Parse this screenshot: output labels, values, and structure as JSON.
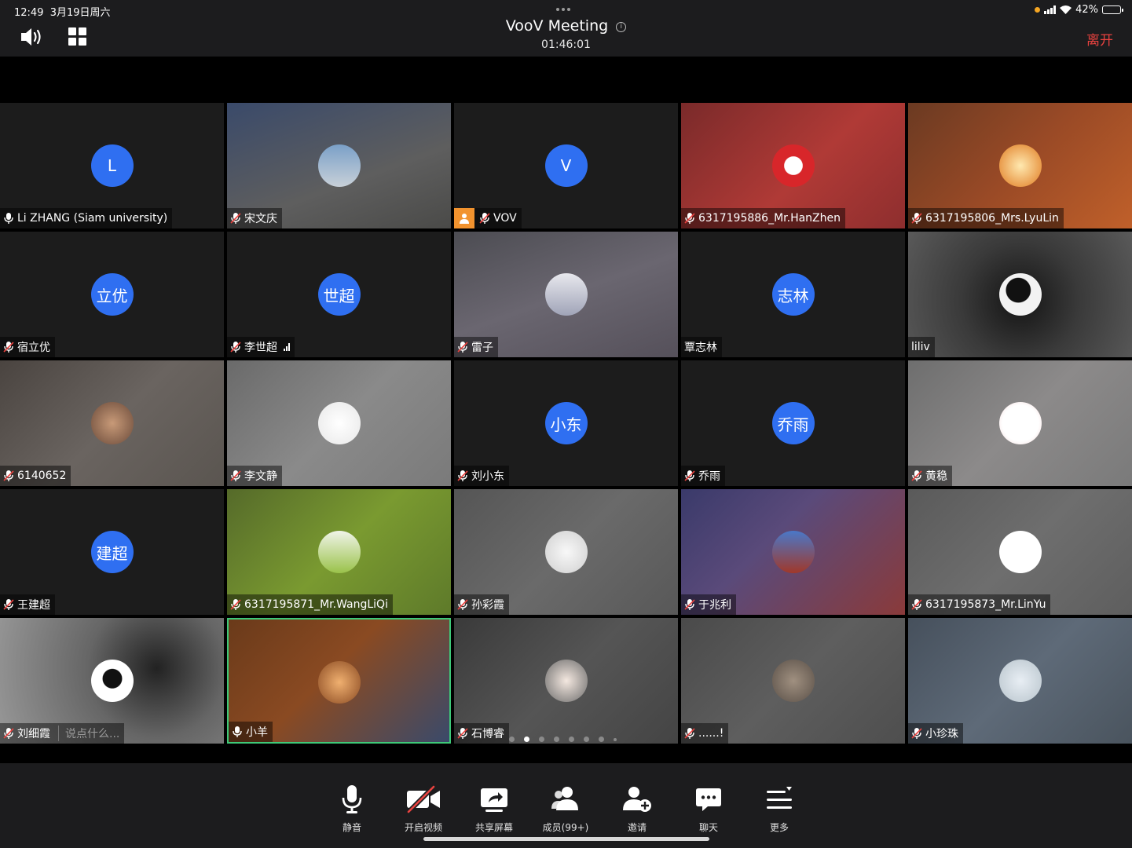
{
  "status_bar": {
    "time": "12:49",
    "date": "3月19日周六",
    "battery_percent_label": "42%",
    "battery_level": 0.42
  },
  "meeting": {
    "title": "VooV Meeting",
    "duration": "01:46:01",
    "leave_label": "离开"
  },
  "colors": {
    "accent_blue": "#2f6ff1",
    "leave_red": "#e8423f",
    "active_border": "#3ec978",
    "screen_share_badge": "#f2932e"
  },
  "icons": {
    "speaker": "speaker-icon",
    "grid": "grid-view-icon",
    "mic_muted": "mic-muted-icon",
    "mic_on": "mic-icon",
    "screen_share": "screen-share-icon",
    "signal": "signal-icon"
  },
  "participants": [
    {
      "name": "Li ZHANG (Siam university)",
      "avatar_text": "L",
      "mic": "on"
    },
    {
      "name": "宋文庆",
      "avatar_text": "",
      "mic": "muted"
    },
    {
      "name": "VOV",
      "avatar_text": "V",
      "mic": "muted",
      "screen_share": true
    },
    {
      "name": "6317195886_Mr.HanZhen",
      "avatar_text": "",
      "mic": "muted"
    },
    {
      "name": "6317195806_Mrs.LyuLin",
      "avatar_text": "",
      "mic": "muted"
    },
    {
      "name": "宿立优",
      "avatar_text": "立优",
      "mic": "muted"
    },
    {
      "name": "李世超",
      "avatar_text": "世超",
      "mic": "muted",
      "signal": true
    },
    {
      "name": "雷子",
      "avatar_text": "",
      "mic": "muted"
    },
    {
      "name": "覃志林",
      "avatar_text": "志林",
      "mic": "none"
    },
    {
      "name": "liliv",
      "avatar_text": "",
      "mic": "none"
    },
    {
      "name": "6140652",
      "avatar_text": "",
      "mic": "muted"
    },
    {
      "name": "李文静",
      "avatar_text": "",
      "mic": "muted"
    },
    {
      "name": "刘小东",
      "avatar_text": "小东",
      "mic": "muted"
    },
    {
      "name": "乔雨",
      "avatar_text": "乔雨",
      "mic": "muted"
    },
    {
      "name": "黄稳",
      "avatar_text": "",
      "mic": "muted"
    },
    {
      "name": "王建超",
      "avatar_text": "建超",
      "mic": "muted"
    },
    {
      "name": "6317195871_Mr.WangLiQi",
      "avatar_text": "",
      "mic": "muted"
    },
    {
      "name": "孙彩霞",
      "avatar_text": "",
      "mic": "muted"
    },
    {
      "name": "于兆利",
      "avatar_text": "",
      "mic": "muted"
    },
    {
      "name": "6317195873_Mr.LinYu",
      "avatar_text": "",
      "mic": "muted"
    },
    {
      "name": "刘细霞",
      "avatar_text": "",
      "mic": "muted",
      "chat_hint": "说点什么..."
    },
    {
      "name": "小羊",
      "avatar_text": "",
      "mic": "on",
      "active": true
    },
    {
      "name": "石博睿",
      "avatar_text": "",
      "mic": "muted"
    },
    {
      "name": "......!",
      "avatar_text": "",
      "mic": "muted"
    },
    {
      "name": "小珍珠",
      "avatar_text": "",
      "mic": "muted"
    }
  ],
  "pagination": {
    "page_count": 8,
    "current_page": 2
  },
  "toolbar": {
    "mute": "静音",
    "video": "开启视频",
    "share": "共享屏幕",
    "members": "成员(99+)",
    "invite": "邀请",
    "chat": "聊天",
    "more": "更多"
  }
}
